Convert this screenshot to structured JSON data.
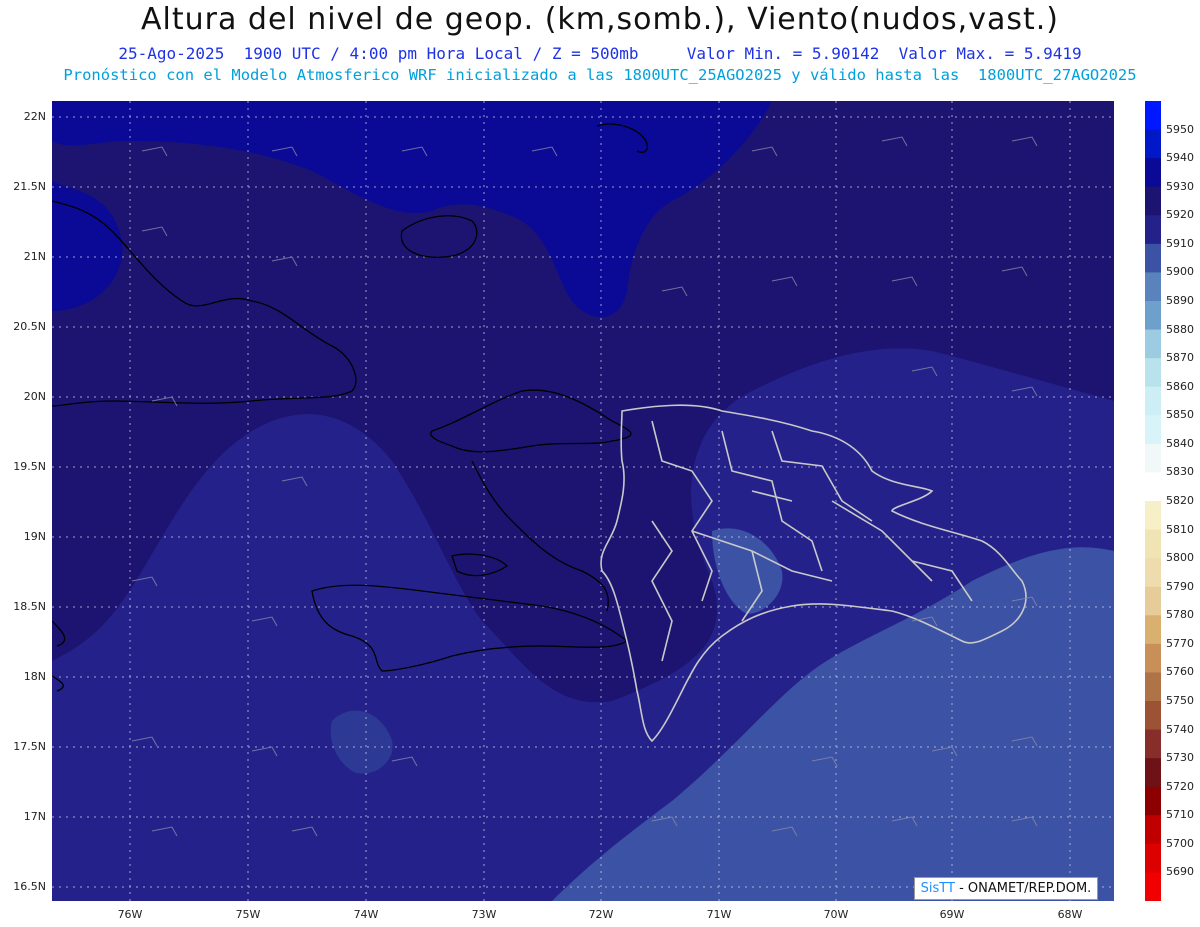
{
  "header": {
    "title": "Altura del nivel de geop. (km,somb.), Viento(nudos,vast.)",
    "line1": "25-Ago-2025  1900 UTC / 4:00 pm Hora Local / Z = 500mb     Valor Min. = 5.90142  Valor Max. = 5.9419",
    "line2": "Pronóstico con el Modelo Atmosferico WRF inicializado a las 1800UTC_25AGO2025 y válido hasta las  1800UTC_27AGO2025"
  },
  "axes": {
    "y_labels": [
      "22N",
      "21.5N",
      "21N",
      "20.5N",
      "20N",
      "19.5N",
      "19N",
      "18.5N",
      "18N",
      "17.5N",
      "17N",
      "16.5N"
    ],
    "x_labels": [
      "76W",
      "75W",
      "74W",
      "73W",
      "72W",
      "71W",
      "70W",
      "69W",
      "68W"
    ]
  },
  "colorbar": {
    "labels": [
      "5950",
      "5940",
      "5930",
      "5920",
      "5910",
      "5900",
      "5890",
      "5880",
      "5870",
      "5860",
      "5850",
      "5840",
      "5830",
      "5820",
      "5810",
      "5800",
      "5790",
      "5780",
      "5770",
      "5760",
      "5750",
      "5740",
      "5730",
      "5720",
      "5710",
      "5700",
      "5690"
    ],
    "colors": [
      "#0018ff",
      "#0018c8",
      "#0a0a96",
      "#1c1470",
      "#24228a",
      "#3c52a4",
      "#5a82bc",
      "#6ea0cc",
      "#9ccbe2",
      "#b8e2ec",
      "#cdeef4",
      "#d8f4f8",
      "#f0f8f8",
      "#ffffff",
      "#f6efc8",
      "#f0e4b4",
      "#eedcae",
      "#e6cc98",
      "#d8b070",
      "#c89058",
      "#ae7448",
      "#9c5234",
      "#882e2a",
      "#6e1218",
      "#8c0000",
      "#c00000",
      "#dc0000",
      "#f00000"
    ]
  },
  "colors": {
    "domain_dark": "#1c1470",
    "domain_mid": "#24228a",
    "domain_light": "#3c52a4",
    "north_blue": "#0a0a96"
  },
  "credit": {
    "sis": "SisTT",
    "org": " - ONAMET/REP.DOM."
  }
}
